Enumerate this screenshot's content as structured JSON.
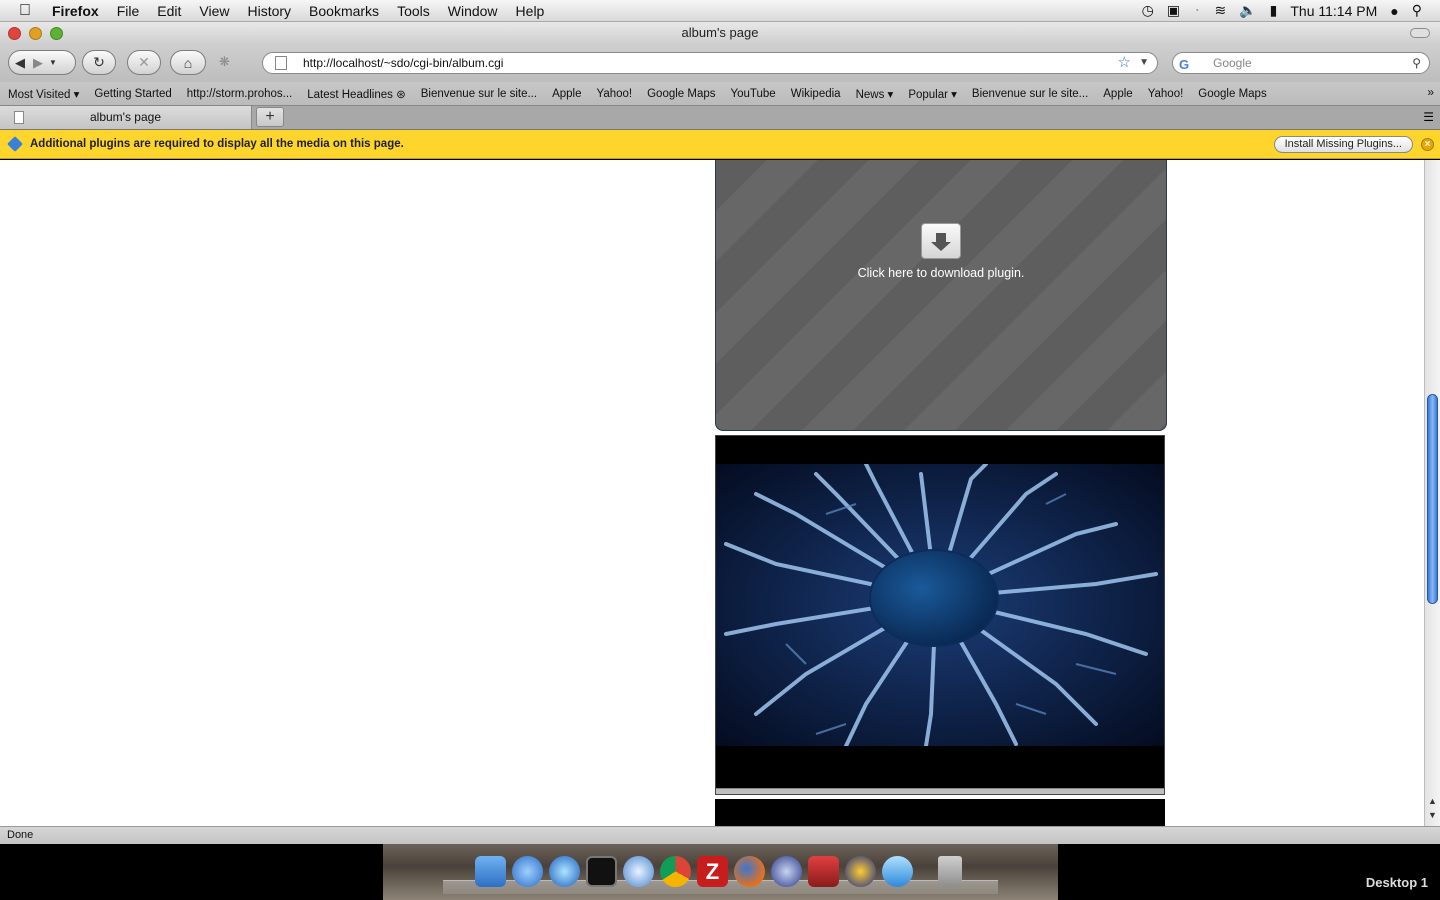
{
  "menubar": {
    "app": "Firefox",
    "items": [
      "File",
      "Edit",
      "View",
      "History",
      "Bookmarks",
      "Tools",
      "Window",
      "Help"
    ],
    "clock": "Thu 11:14 PM"
  },
  "window": {
    "title": "album's page"
  },
  "navbar": {
    "url": "http://localhost/~sdo/cgi-bin/album.cgi",
    "search_placeholder": "Google"
  },
  "bookmarks": [
    "Most Visited ▾",
    "Getting Started",
    "http://storm.prohos...",
    "Latest Headlines ⊛",
    "Bienvenue sur le site...",
    "Apple",
    "Yahoo!",
    "Google Maps",
    "YouTube",
    "Wikipedia",
    "News ▾",
    "Popular ▾",
    "Bienvenue sur le site...",
    "Apple",
    "Yahoo!",
    "Google Maps"
  ],
  "tab": {
    "label": "album's page",
    "new_tab": "+"
  },
  "notification": {
    "message": "Additional plugins are required to display all the media on this page.",
    "install_label": "Install Missing Plugins...",
    "close_label": "×"
  },
  "plugin_box": {
    "text": "Click here to download plugin."
  },
  "status": "Done",
  "desktop_label": "Desktop 1",
  "colors": {
    "notification": "#fdd52c",
    "scroll_thumb": "#3b78d8"
  }
}
